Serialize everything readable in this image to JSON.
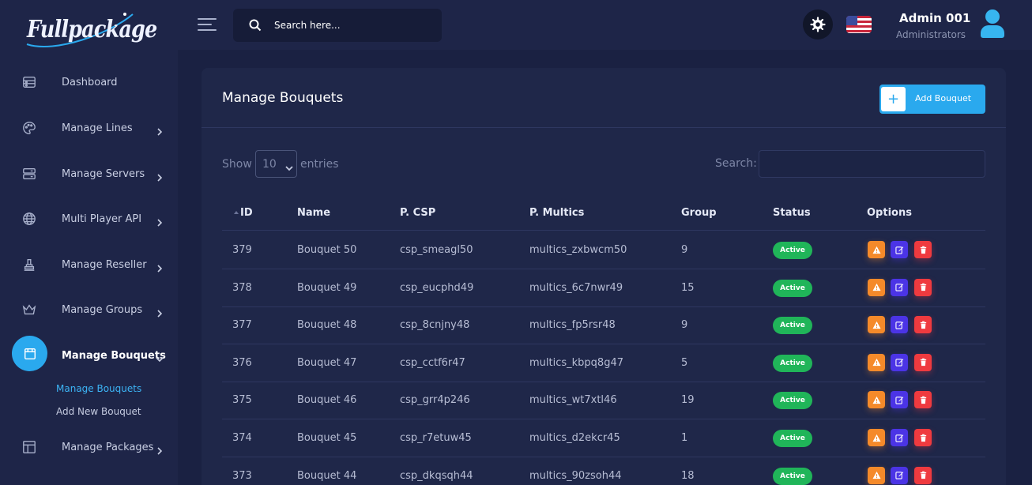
{
  "brand": {
    "logo_text": "Fullpackage"
  },
  "sidebar": {
    "items": [
      {
        "label": "Dashboard",
        "icon": "dashboard-icon",
        "has_chevron": false
      },
      {
        "label": "Manage Lines",
        "icon": "palette-icon",
        "has_chevron": true
      },
      {
        "label": "Manage Servers",
        "icon": "server-icon",
        "has_chevron": true
      },
      {
        "label": "Multi Player API",
        "icon": "globe-icon",
        "has_chevron": true
      },
      {
        "label": "Manage Reseller",
        "icon": "stamp-icon",
        "has_chevron": true
      },
      {
        "label": "Manage Groups",
        "icon": "crown-icon",
        "has_chevron": true
      },
      {
        "label": "Manage Bouquets",
        "icon": "calendar-icon",
        "has_chevron": true,
        "active": true
      },
      {
        "label": "Manage Packages",
        "icon": "layout-icon",
        "has_chevron": true
      }
    ],
    "subitems": [
      {
        "label": "Manage Bouquets",
        "active": true
      },
      {
        "label": "Add New Bouquet",
        "active": false
      }
    ]
  },
  "header": {
    "search_placeholder": "Search here...",
    "user_name": "Admin 001",
    "user_role": "Administrators",
    "flag": "us-flag-icon"
  },
  "card": {
    "title": "Manage Bouquets",
    "add_button_label": "Add Bouquet",
    "show_label": "Show",
    "entries_value": "10",
    "entries_label": "entries",
    "search_label": "Search:"
  },
  "table": {
    "columns": [
      "ID",
      "Name",
      "P. CSP",
      "P. Multics",
      "Group",
      "Status",
      "Options"
    ],
    "rows": [
      {
        "id": "379",
        "name": "Bouquet 50",
        "csp": "csp_smeagl50",
        "multics": "multics_zxbwcm50",
        "group": "9",
        "status": "Active"
      },
      {
        "id": "378",
        "name": "Bouquet 49",
        "csp": "csp_eucphd49",
        "multics": "multics_6c7nwr49",
        "group": "15",
        "status": "Active"
      },
      {
        "id": "377",
        "name": "Bouquet 48",
        "csp": "csp_8cnjny48",
        "multics": "multics_fp5rsr48",
        "group": "9",
        "status": "Active"
      },
      {
        "id": "376",
        "name": "Bouquet 47",
        "csp": "csp_cctf6r47",
        "multics": "multics_kbpq8g47",
        "group": "5",
        "status": "Active"
      },
      {
        "id": "375",
        "name": "Bouquet 46",
        "csp": "csp_grr4p246",
        "multics": "multics_wt7xtl46",
        "group": "19",
        "status": "Active"
      },
      {
        "id": "374",
        "name": "Bouquet 45",
        "csp": "csp_r7etuw45",
        "multics": "multics_d2ekcr45",
        "group": "1",
        "status": "Active"
      },
      {
        "id": "373",
        "name": "Bouquet 44",
        "csp": "csp_dkqsqh44",
        "multics": "multics_90zsoh44",
        "group": "18",
        "status": "Active"
      }
    ]
  },
  "colors": {
    "accent": "#2aa9ee",
    "active_badge": "#20b559",
    "warn_button": "#f58a2a",
    "edit_button": "#4b34e6",
    "delete_button": "#ef3a3f"
  }
}
